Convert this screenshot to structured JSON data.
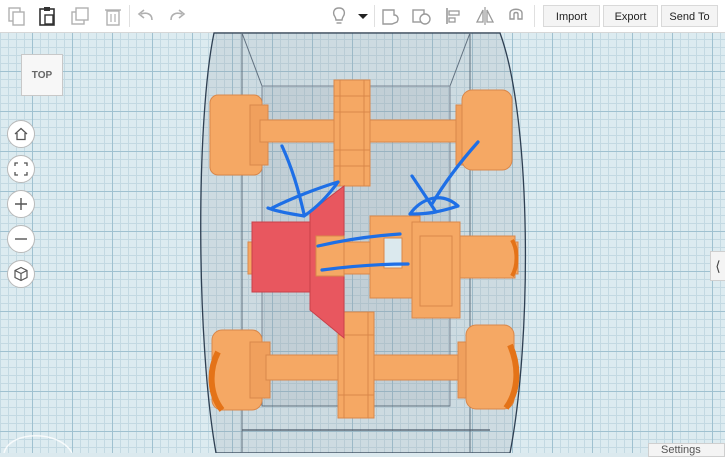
{
  "toolbar": {
    "import_label": "Import",
    "export_label": "Export",
    "send_to_label": "Send To",
    "icons": [
      "copy-icon",
      "paste-icon",
      "duplicate-icon",
      "trash-icon",
      "undo-icon",
      "redo-icon",
      "lightbulb-icon",
      "dropdown-icon",
      "group-icon",
      "ungroup-icon",
      "align-icon",
      "mirror-icon",
      "magnet-icon"
    ]
  },
  "viewcube": {
    "label": "TOP"
  },
  "navigation": {
    "icons": [
      "home-icon",
      "fit-view-icon",
      "zoom-in-icon",
      "zoom-out-icon",
      "perspective-icon"
    ]
  },
  "right_panel": {
    "toggle_label": "⟨"
  },
  "settings": {
    "label": "Settings"
  },
  "colors": {
    "accent": "#1f73e3",
    "model_orange": "#f5a864",
    "model_red": "#e8575f",
    "annotation_blue": "#1e6fe6"
  }
}
